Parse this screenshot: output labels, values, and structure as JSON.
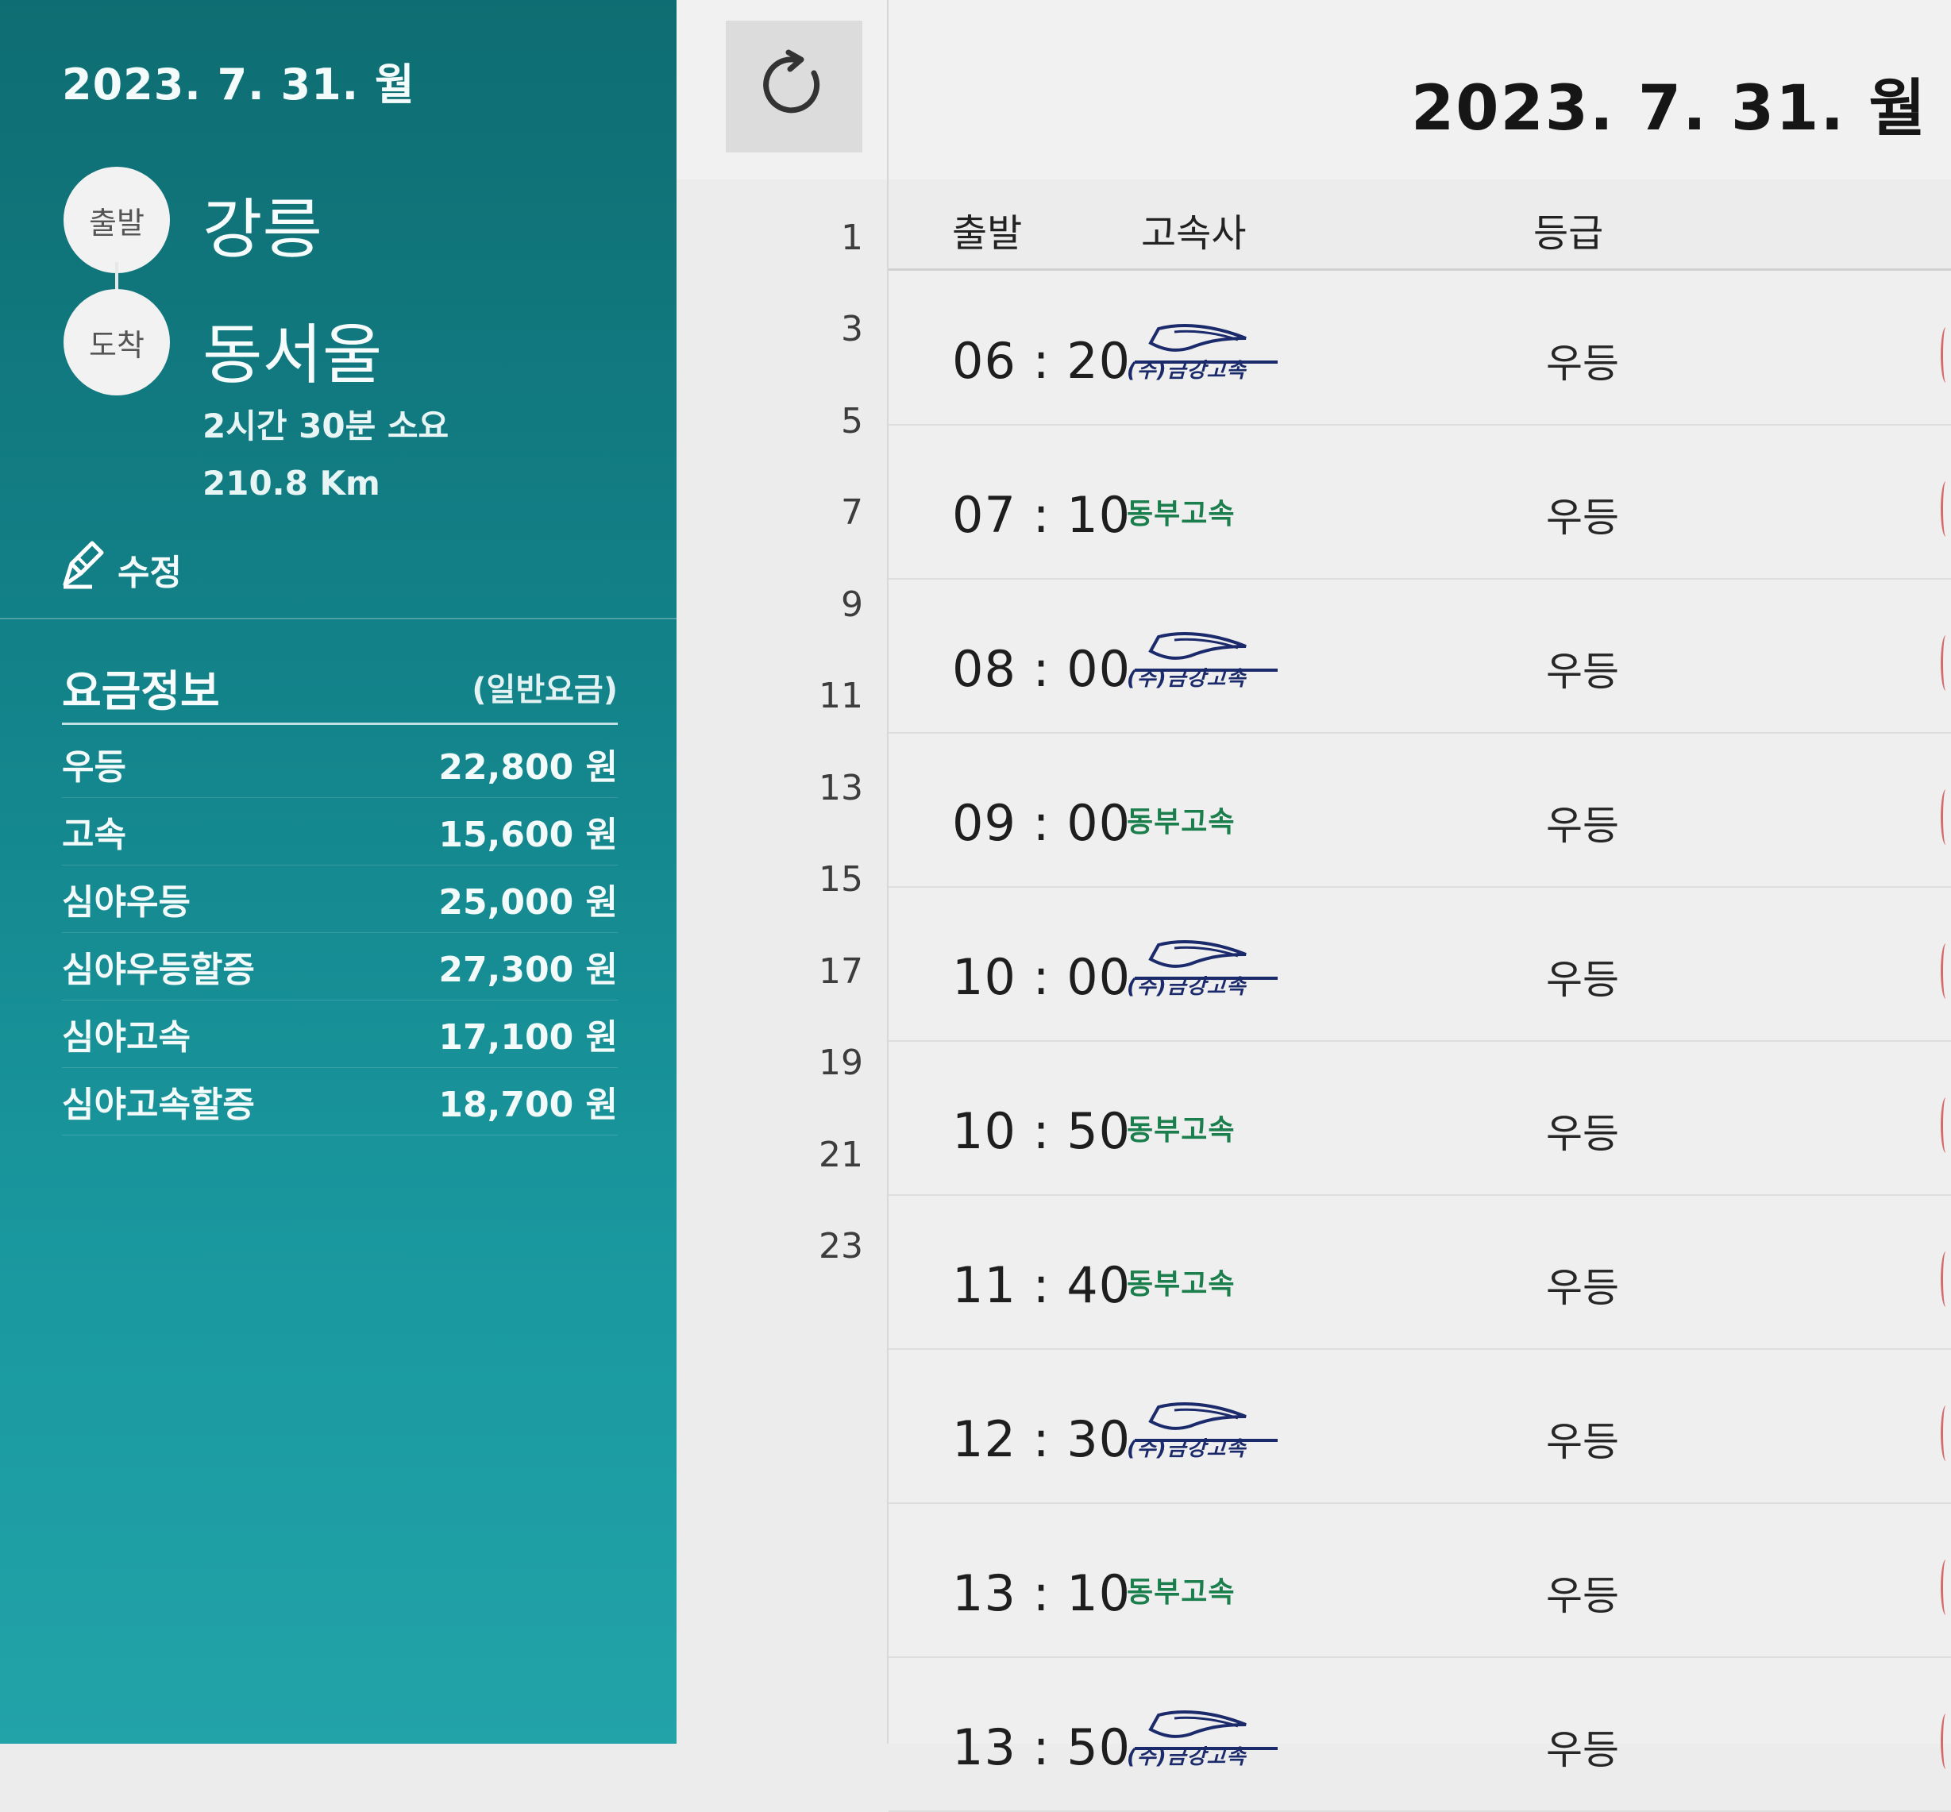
{
  "left_panel": {
    "date": "2023. 7. 31. 월",
    "departure": {
      "badge": "출발",
      "name": "강릉"
    },
    "arrival": {
      "badge": "도착",
      "name": "동서울"
    },
    "duration": "2시간 30분 소요",
    "distance": "210.8 Km",
    "edit_label": "수정"
  },
  "fare_info": {
    "title": "요금정보",
    "subtitle": "(일반요금)",
    "rows": [
      {
        "label": "우등",
        "price": "22,800 원"
      },
      {
        "label": "고속",
        "price": "15,600 원"
      },
      {
        "label": "심야우등",
        "price": "25,000 원"
      },
      {
        "label": "심야우등할증",
        "price": "27,300 원"
      },
      {
        "label": "심야고속",
        "price": "17,100 원"
      },
      {
        "label": "심야고속할증",
        "price": "18,700 원"
      }
    ]
  },
  "header": {
    "date": "2023. 7. 31. 월"
  },
  "side_numbers": [
    "1",
    "3",
    "5",
    "7",
    "9",
    "11",
    "13",
    "15",
    "17",
    "19",
    "21",
    "23"
  ],
  "table": {
    "columns": {
      "departure": "출발",
      "company": "고속사",
      "grade": "등급"
    },
    "rows": [
      {
        "time": "06 : 20",
        "company": "(주)금강고속",
        "grade": "우등"
      },
      {
        "time": "07 : 10",
        "company": "동부고속",
        "grade": "우등"
      },
      {
        "time": "08 : 00",
        "company": "(주)금강고속",
        "grade": "우등"
      },
      {
        "time": "09 : 00",
        "company": "동부고속",
        "grade": "우등"
      },
      {
        "time": "10 : 00",
        "company": "(주)금강고속",
        "grade": "우등"
      },
      {
        "time": "10 : 50",
        "company": "동부고속",
        "grade": "우등"
      },
      {
        "time": "11 : 40",
        "company": "동부고속",
        "grade": "우등"
      },
      {
        "time": "12 : 30",
        "company": "(주)금강고속",
        "grade": "우등"
      },
      {
        "time": "13 : 10",
        "company": "동부고속",
        "grade": "우등"
      },
      {
        "time": "13 : 50",
        "company": "(주)금강고속",
        "grade": "우등"
      }
    ]
  },
  "colors": {
    "panel_teal_top": "#0e6d72",
    "panel_teal_bottom": "#22a3a8",
    "dongbu_green": "#1a7f4c",
    "kumho_navy": "#1b2a6b"
  },
  "icons": {
    "refresh": "refresh-icon",
    "edit": "pencil-icon",
    "kumho_logo": "greyhound-logo"
  }
}
